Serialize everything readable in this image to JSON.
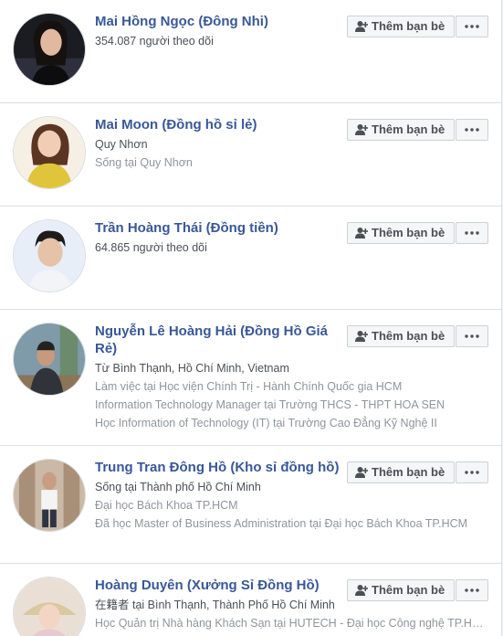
{
  "button_label": "Thêm bạn bè",
  "accent": "#385898",
  "people": [
    {
      "name": "Mai Hồng Ngọc (Đông Nhi)",
      "lines": [
        {
          "text": "354.087 người theo dõi",
          "tone": "dark"
        }
      ]
    },
    {
      "name": "Mai Moon (Đồng hồ sỉ lẻ)",
      "lines": [
        {
          "text": "Quy Nhơn",
          "tone": "dark"
        },
        {
          "text": "Sống tại Quy Nhơn",
          "tone": "grey"
        }
      ]
    },
    {
      "name": "Trần Hoàng Thái (Đồng tiền)",
      "lines": [
        {
          "text": "64.865 người theo dõi",
          "tone": "dark"
        }
      ]
    },
    {
      "name": "Nguyễn Lê Hoàng Hải (Đồng Hồ Giá Rẻ)",
      "lines": [
        {
          "text": "Từ Bình Thạnh, Hồ Chí Minh, Vietnam",
          "tone": "dark"
        },
        {
          "text": "Làm việc tại Học viện Chính Trị - Hành Chính Quốc gia HCM",
          "tone": "grey"
        },
        {
          "text": "Information Technology Manager tại Trường THCS - THPT HOA SEN",
          "tone": "grey"
        },
        {
          "text": "Học Information of Technology (IT) tại Trường Cao Đẳng Kỹ Nghệ II",
          "tone": "grey"
        }
      ]
    },
    {
      "name": "Trung Tran Đông Hồ (Kho sỉ đồng hồ)",
      "lines": [
        {
          "text": "Sống tại Thành phố Hồ Chí Minh",
          "tone": "dark"
        },
        {
          "text": "Đại học Bách Khoa TP.HCM",
          "tone": "grey"
        },
        {
          "text": "Đã học Master of Business Administration tại Đại học Bách Khoa TP.HCM",
          "tone": "grey"
        }
      ]
    },
    {
      "name": "Hoàng Duyên (Xưởng Sỉ Đồng Hồ)",
      "lines": [
        {
          "text": "在籍者 tại Bình Thạnh, Thành Phố Hồ Chí Minh",
          "tone": "dark"
        },
        {
          "text": "Học Quản trị Nhà hàng Khách Sạn tại HUTECH - Đại học Công nghệ TP.HCM",
          "tone": "grey"
        }
      ]
    }
  ]
}
